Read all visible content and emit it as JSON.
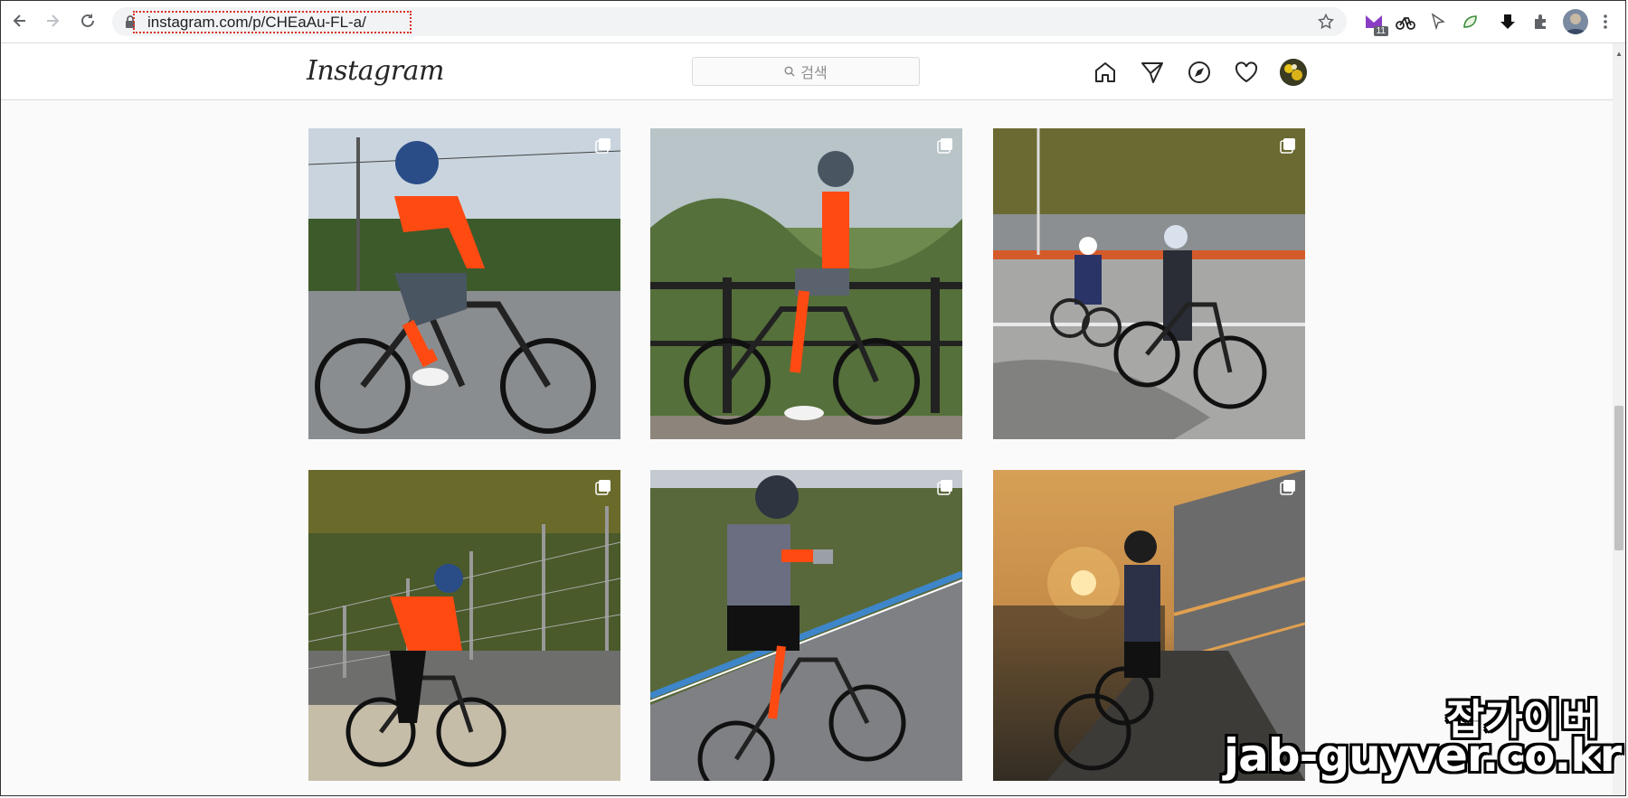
{
  "browser": {
    "url": "instagram.com/p/CHEaAu-FL-a/",
    "extensions": [
      "mail-extension-icon",
      "bike-extension-icon",
      "cursor-extension-icon",
      "leaf-extension-icon",
      "download-extension-icon",
      "puzzle-extensions-icon",
      "profile-avatar"
    ],
    "extension_badge": "11"
  },
  "instagram": {
    "logo": "Instagram",
    "search_placeholder": "검색",
    "nav": [
      "home-icon",
      "direct-message-icon",
      "explore-compass-icon",
      "activity-heart-icon",
      "profile-avatar"
    ]
  },
  "grid": {
    "posts": [
      {
        "scene": "cyclist-orange-jersey-seated-on-bike",
        "multiple_images": true
      },
      {
        "scene": "cyclist-leaning-on-railing",
        "multiple_images": true
      },
      {
        "scene": "two-cyclists-on-road",
        "multiple_images": true
      },
      {
        "scene": "cyclist-riding-past-fence",
        "multiple_images": true
      },
      {
        "scene": "cyclist-taking-selfie-on-road",
        "multiple_images": true
      },
      {
        "scene": "cyclist-at-sunset",
        "multiple_images": true
      }
    ]
  },
  "watermark": {
    "korean": "잡가이버",
    "url": "jab-guyver.co.kr"
  },
  "colors": {
    "accent_orange": "#ff4a12",
    "highlight_red": "#d93025",
    "header_border": "#dbdbdb"
  }
}
